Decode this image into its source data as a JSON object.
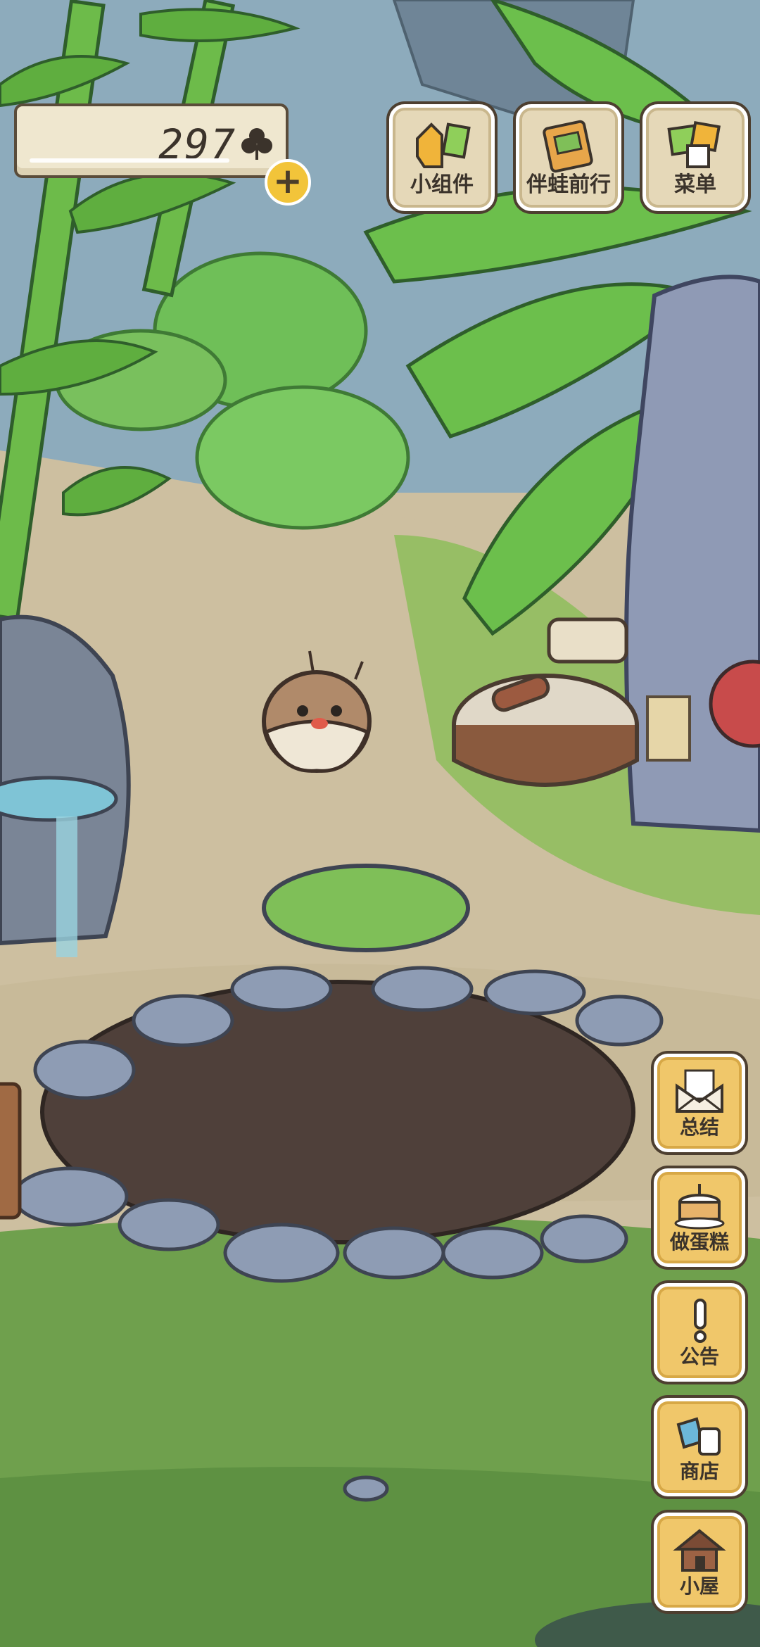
{
  "hud": {
    "clover_count": "297",
    "clover_icon": "clover-icon",
    "add_icon": "plus-icon"
  },
  "top_menu": [
    {
      "id": "widgets",
      "label": "小组件",
      "icon": "folder-card-icon"
    },
    {
      "id": "travel",
      "label": "伴蛙前行",
      "icon": "album-icon"
    },
    {
      "id": "menu",
      "label": "菜单",
      "icon": "cards-icon"
    }
  ],
  "side_menu": [
    {
      "id": "summary",
      "label": "总结",
      "icon": "envelope-letter-icon"
    },
    {
      "id": "cake",
      "label": "做蛋糕",
      "icon": "cake-icon"
    },
    {
      "id": "notice",
      "label": "公告",
      "icon": "exclamation-icon"
    },
    {
      "id": "shop",
      "label": "商店",
      "icon": "shop-bags-icon"
    },
    {
      "id": "house",
      "label": "小屋",
      "icon": "house-icon"
    }
  ],
  "colors": {
    "tile_beige": "#e5d8b8",
    "tile_gold": "#f0c76a",
    "plus_yellow": "#f2c43a",
    "soil": "#4f403a",
    "leaf": "#5fae3f"
  }
}
